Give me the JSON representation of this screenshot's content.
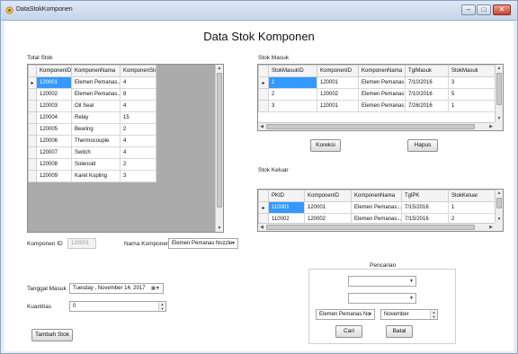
{
  "window": {
    "title": "DataStokKomponen",
    "heading": "Data Stok Komponen"
  },
  "total_stok": {
    "label": "Total Stok",
    "columns": [
      "KomponenID",
      "KomponenNama",
      "KomponenStok"
    ],
    "rows": [
      [
        "120001",
        "Elemen Pemanas...",
        "4"
      ],
      [
        "120002",
        "Elemen Pemanas...",
        "8"
      ],
      [
        "120003",
        "Oil Seal",
        "4"
      ],
      [
        "120004",
        "Relay",
        "15"
      ],
      [
        "120005",
        "Bearing",
        "2"
      ],
      [
        "120006",
        "Thermocouple",
        "4"
      ],
      [
        "120007",
        "Switch",
        "4"
      ],
      [
        "120008",
        "Solenoid",
        "2"
      ],
      [
        "120009",
        "Karet Kopling",
        "3"
      ]
    ]
  },
  "stok_masuk": {
    "label": "Stok Masuk",
    "columns": [
      "StokMasukID",
      "KomponenID",
      "KomponenNama",
      "TglMasuk",
      "StokMasuk"
    ],
    "rows": [
      [
        "1",
        "120001",
        "Elemen Pemanas...",
        "7/10/2016",
        "3"
      ],
      [
        "2",
        "120002",
        "Elemen Pemanas...",
        "7/10/2016",
        "5"
      ],
      [
        "3",
        "120001",
        "Elemen Pemanas...",
        "7/26/2016",
        "1"
      ]
    ]
  },
  "stok_keluar": {
    "label": "Stok Keluar",
    "columns": [
      "PKID",
      "KomponenID",
      "KomponenNama",
      "TglPK",
      "StokKeluar"
    ],
    "rows": [
      [
        "110001",
        "120001",
        "Elemen Pemanas...",
        "7/15/2016",
        "1"
      ],
      [
        "110002",
        "120002",
        "Elemen Pemanas...",
        "7/15/2016",
        "2"
      ]
    ]
  },
  "buttons": {
    "koreksi": "Koreksi",
    "hapus": "Hapus",
    "tambah": "Tambah Stok",
    "cari": "Cari",
    "batal": "Batal"
  },
  "form": {
    "komponen_id_label": "Komponen ID",
    "komponen_id_value": "120001",
    "nama_komponen_label": "Nama Komponen",
    "nama_komponen_value": "Elemen Pemanas Nozzle",
    "tanggal_masuk_label": "Tanggal Masuk",
    "tanggal_masuk_value": "Tuesday , November 14, 2017",
    "kuantitas_label": "Kuantitas",
    "kuantitas_value": "0"
  },
  "pencarian": {
    "label": "Pencarian",
    "combo1": "",
    "combo2": "",
    "combo3": "Elemen Pemanas No",
    "month": "November"
  }
}
